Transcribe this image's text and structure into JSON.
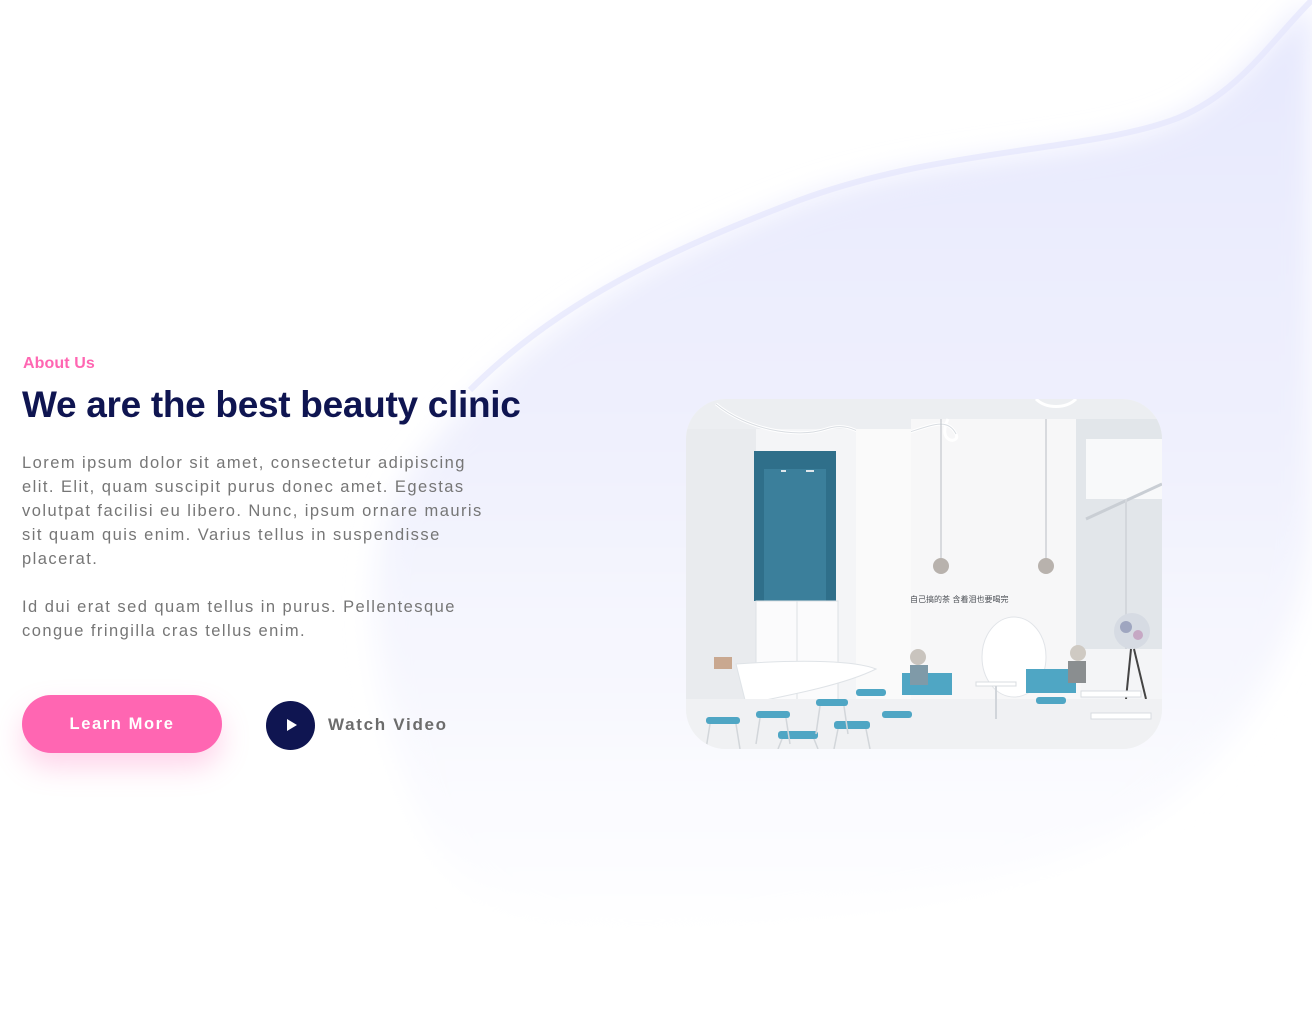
{
  "about": {
    "eyebrow": "About Us",
    "heading": "We are the best beauty clinic",
    "paragraph_1": "Lorem ipsum dolor sit amet, consectetur adipiscing elit. Elit, quam suscipit purus donec amet. Egestas volutpat facilisi eu libero. Nunc, ipsum ornare mauris sit quam quis enim. Varius tellus in suspendisse placerat.",
    "paragraph_2": "Id dui erat sed quam tellus in purus. Pellentesque congue fringilla cras tellus enim."
  },
  "buttons": {
    "learn_more": "Learn More",
    "watch_video": "Watch Video"
  },
  "icons": {
    "play": "play-icon"
  },
  "photo": {
    "wall_sign": "自己搞的茶 含着泪也要喝完"
  },
  "colors": {
    "accent_pink": "#ff66b2",
    "navy": "#0f1551",
    "body_text": "#767676",
    "background_blob": "#e9ebff",
    "photo_teal": "#4fa6c4"
  }
}
